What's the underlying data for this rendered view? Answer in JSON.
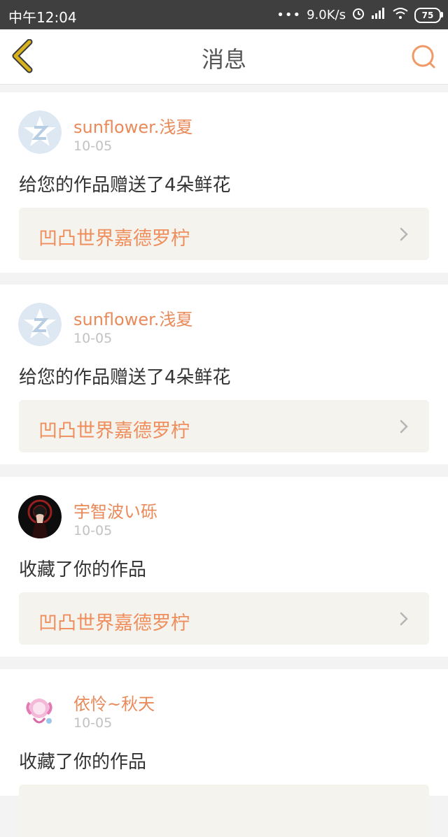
{
  "status": {
    "time": "中午12:04",
    "speed": "9.0K/s",
    "battery": "75"
  },
  "nav": {
    "title": "消息"
  },
  "messages": [
    {
      "username": "sunflower.浅夏",
      "date": "10-05",
      "action": "给您的作品赠送了4朵鲜花",
      "work_title": "凹凸世界嘉德罗柠"
    },
    {
      "username": "sunflower.浅夏",
      "date": "10-05",
      "action": "给您的作品赠送了4朵鲜花",
      "work_title": "凹凸世界嘉德罗柠"
    },
    {
      "username": "宇智波い砾",
      "date": "10-05",
      "action": "收藏了你的作品",
      "work_title": "凹凸世界嘉德罗柠"
    },
    {
      "username": "依怜~秋天",
      "date": "10-05",
      "action": "收藏了你的作品",
      "work_title": ""
    }
  ],
  "colors": {
    "accent": "#ef8e5c",
    "username": "#e98a5a",
    "back_icon": "#c9a319",
    "card_bg": "#ffffff",
    "work_box_bg": "#f4f3ee"
  }
}
